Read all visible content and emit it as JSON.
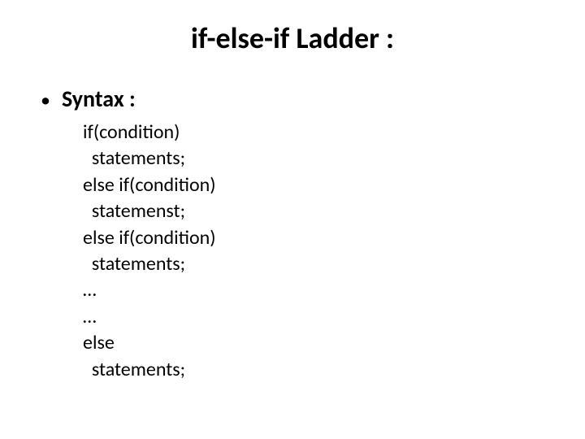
{
  "title": "if-else-if Ladder :",
  "bullet_label": "Syntax :",
  "code": {
    "l1": "if(condition)",
    "l2": "  statements;",
    "l3": "else if(condition)",
    "l4": "  statemenst;",
    "l5": "else if(condition)",
    "l6": "  statements;",
    "l7": "…",
    "l8": "…",
    "l9": "else",
    "l10": "  statements;"
  }
}
